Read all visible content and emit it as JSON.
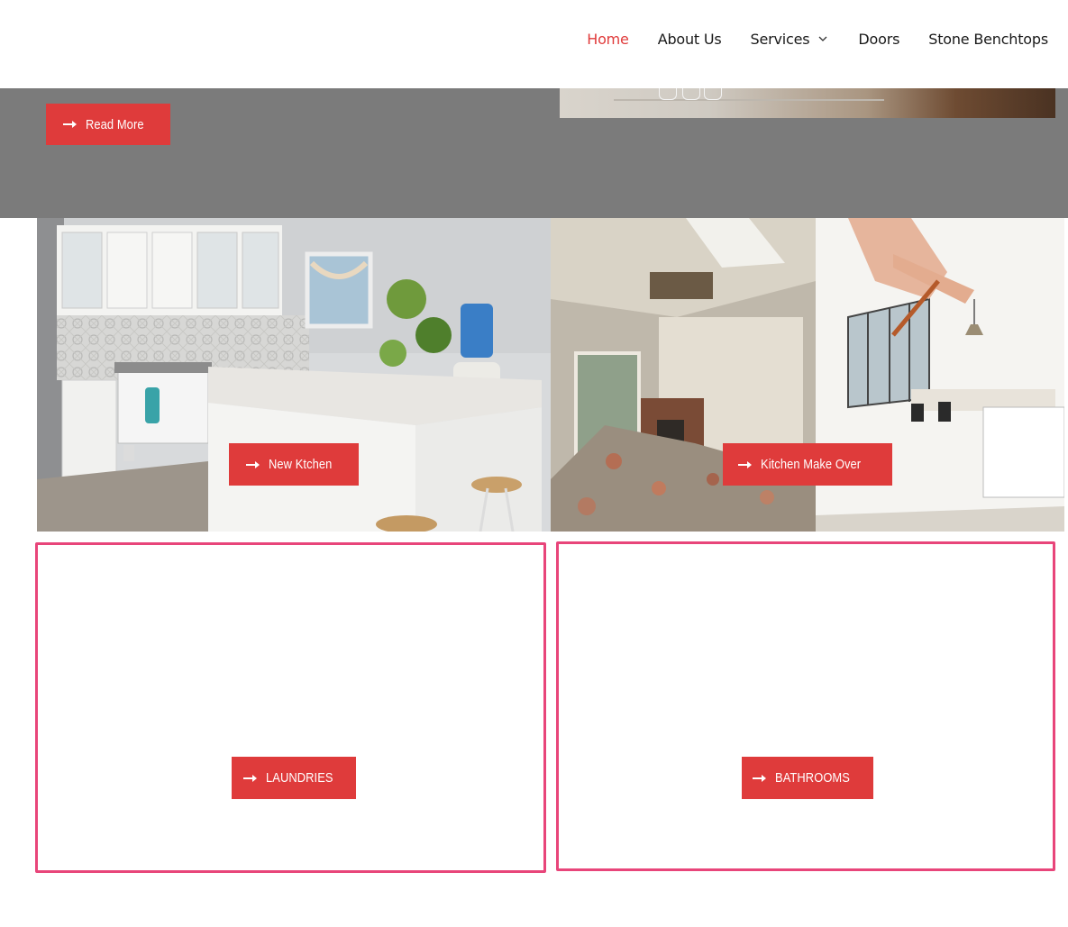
{
  "nav": {
    "items": [
      {
        "label": "Home",
        "active": true
      },
      {
        "label": "About Us",
        "active": false
      },
      {
        "label": "Services",
        "active": false,
        "has_dropdown": true
      },
      {
        "label": "Doors",
        "active": false
      },
      {
        "label": "Stone Benchtops",
        "active": false
      }
    ]
  },
  "hero": {
    "button_label": "Read More"
  },
  "tiles": {
    "new_kitchen": {
      "button_label": "New Ktchen"
    },
    "makeover": {
      "button_label": "Kitchen Make Over"
    },
    "laundries": {
      "button_label": "LAUNDRIES"
    },
    "bathrooms": {
      "button_label": "BATHROOMS"
    }
  },
  "icons": {
    "button_icon": "long-arrow-right-icon",
    "dropdown_icon": "chevron-down-icon"
  },
  "colors": {
    "accent": "#df3b3b",
    "active_nav": "#e03b3b",
    "hero_bg": "#7b7b7b",
    "frame_border": "#e8457a",
    "text": "#1a1a1a"
  }
}
